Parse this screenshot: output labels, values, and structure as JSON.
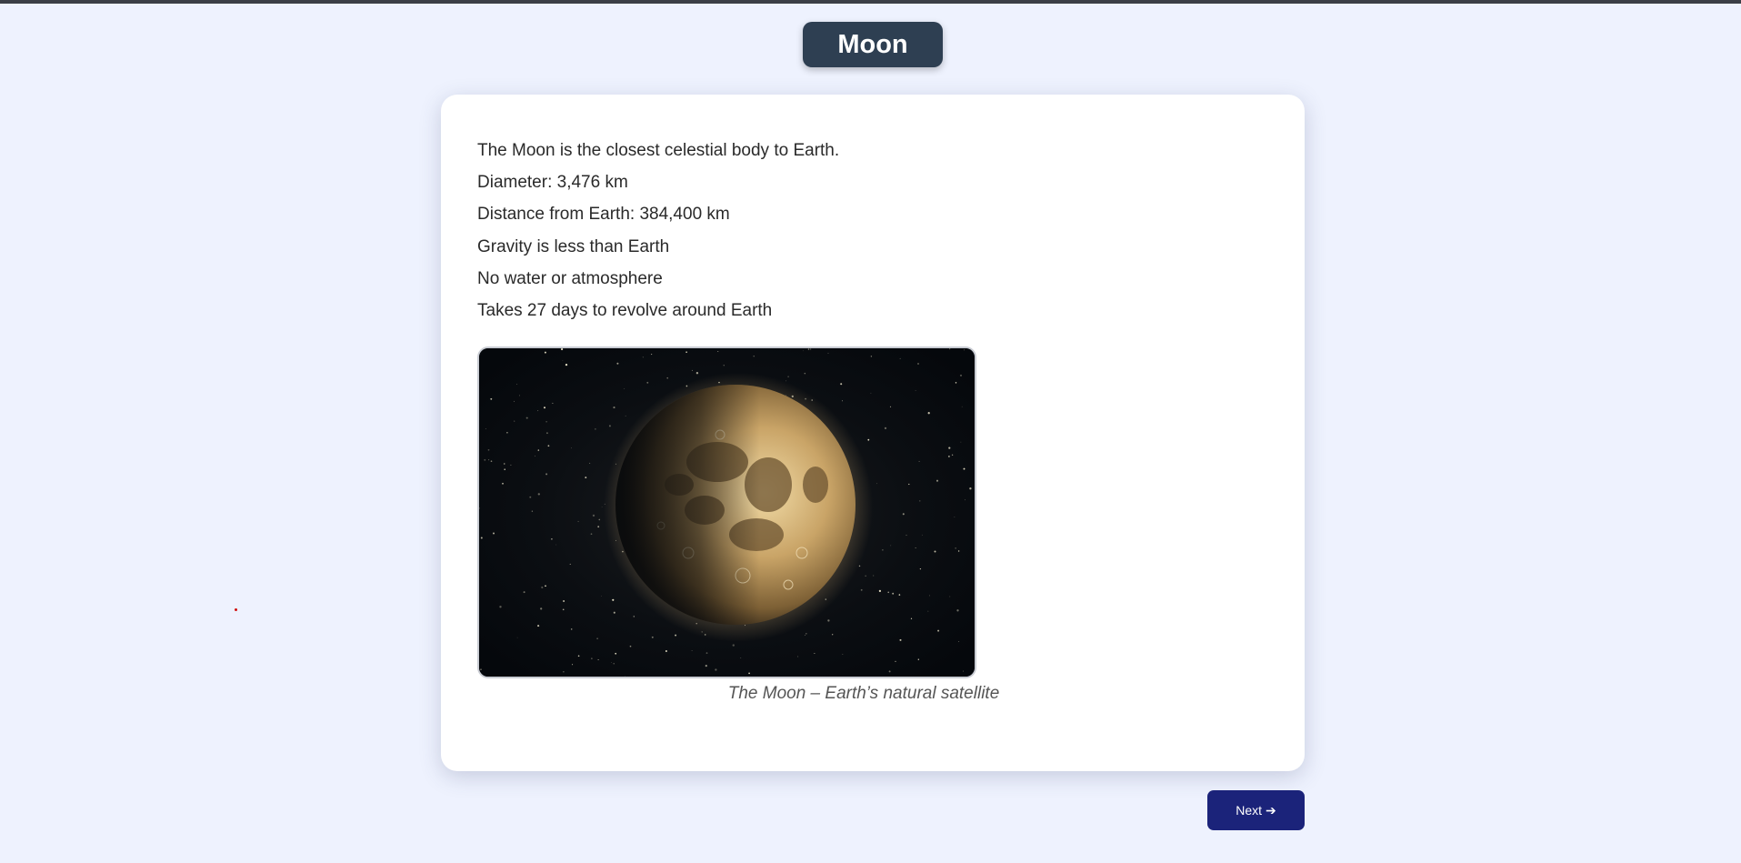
{
  "header": {
    "title": "Moon"
  },
  "content": {
    "facts": [
      "The Moon is the closest celestial body to Earth.",
      "Diameter: 3,476 km",
      "Distance from Earth: 384,400 km",
      "Gravity is less than Earth",
      "No water or atmosphere",
      "Takes 27 days to revolve around Earth"
    ],
    "image": {
      "icon": "moon-photo",
      "caption": "The Moon – Earth’s natural satellite"
    }
  },
  "navigation": {
    "next_label": "Next",
    "next_icon": "arrow-right-icon",
    "next_arrow": "➔"
  },
  "colors": {
    "background": "#eef2fe",
    "title_bg": "#2e3f52",
    "button_bg": "#1b237a",
    "card_bg": "#ffffff"
  }
}
